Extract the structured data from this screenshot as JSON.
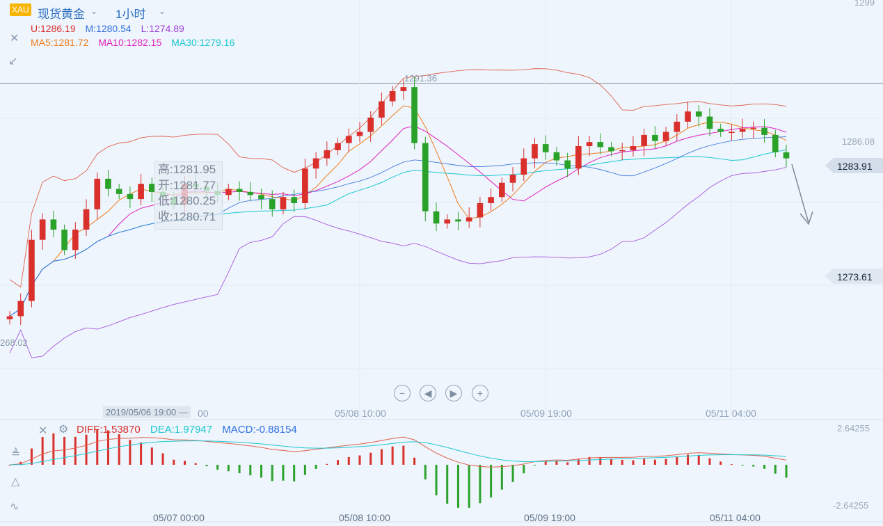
{
  "header": {
    "badge": "XAU",
    "symbol": "现货黄金",
    "period": "1小时"
  },
  "legend": {
    "boll": [
      {
        "label": "U:1286.19",
        "color": "#d9302c"
      },
      {
        "label": "M:1280.54",
        "color": "#2f6fe0"
      },
      {
        "label": "L:1274.89",
        "color": "#a040d8"
      }
    ],
    "ma": [
      {
        "label": "MA5:1281.72",
        "color": "#f07c1a"
      },
      {
        "label": "MA10:1282.15",
        "color": "#e020c0"
      },
      {
        "label": "MA30:1279.16",
        "color": "#1cc7d0"
      }
    ]
  },
  "price_axis": {
    "top": "1299",
    "mid": "1286.08",
    "right_tag_1": "1283.91",
    "right_tag_2": "1273.61",
    "high_label": "1291.36",
    "low_label": "268.02"
  },
  "tooltip": {
    "high": "高:1281.95",
    "open": "开:1281.77",
    "low": "低:1280.25",
    "close": "收:1280.71"
  },
  "cross_date": "2019/05/06 19:00 —",
  "time_axis_main": [
    "00",
    "05/08 10:00",
    "05/09 19:00",
    "05/11 04:00"
  ],
  "time_axis_bottom": [
    "05/07 00:00",
    "05/08 10:00",
    "05/09 19:00",
    "05/11 04:00"
  ],
  "macd_legend": [
    {
      "label": "DIFF:1.53870",
      "color": "#d9302c"
    },
    {
      "label": "DEA:1.97947",
      "color": "#1cc7d0"
    },
    {
      "label": "MACD:-0.88154",
      "color": "#2f6fe0"
    }
  ],
  "macd_axis": {
    "top": "2.64255",
    "bottom": "-2.64255"
  },
  "icons": [
    "close-icon",
    "collapse-icon",
    "gear-icon",
    "tool-icons"
  ],
  "chart_data": {
    "type": "candlestick",
    "interval": "1h",
    "ylim": [
      1263,
      1299
    ],
    "closes_approx": [
      1268.5,
      1270,
      1276,
      1278,
      1277,
      1275,
      1277,
      1279,
      1282,
      1281,
      1280.5,
      1280,
      1281.5,
      1280.7,
      1280.2,
      1279.5,
      1281.5,
      1281.2,
      1280.8,
      1280.4,
      1281,
      1280.7,
      1280.4,
      1280,
      1279,
      1280.2,
      1279.6,
      1283,
      1284,
      1284.8,
      1285.5,
      1286.2,
      1286.6,
      1288,
      1289.6,
      1290.6,
      1291,
      1285.5,
      1278.8,
      1277.6,
      1278,
      1277.8,
      1278.2,
      1279.6,
      1280.2,
      1281.6,
      1282.4,
      1284,
      1285.4,
      1284.6,
      1283.8,
      1283,
      1285.2,
      1285.6,
      1285.1,
      1284.7,
      1284.8,
      1285.2,
      1286.3,
      1285.7,
      1286.6,
      1287.6,
      1288.6,
      1288.1,
      1286.9,
      1286.6,
      1286.6,
      1286.9,
      1287.0,
      1286.3,
      1284.6,
      1284.0
    ]
  }
}
